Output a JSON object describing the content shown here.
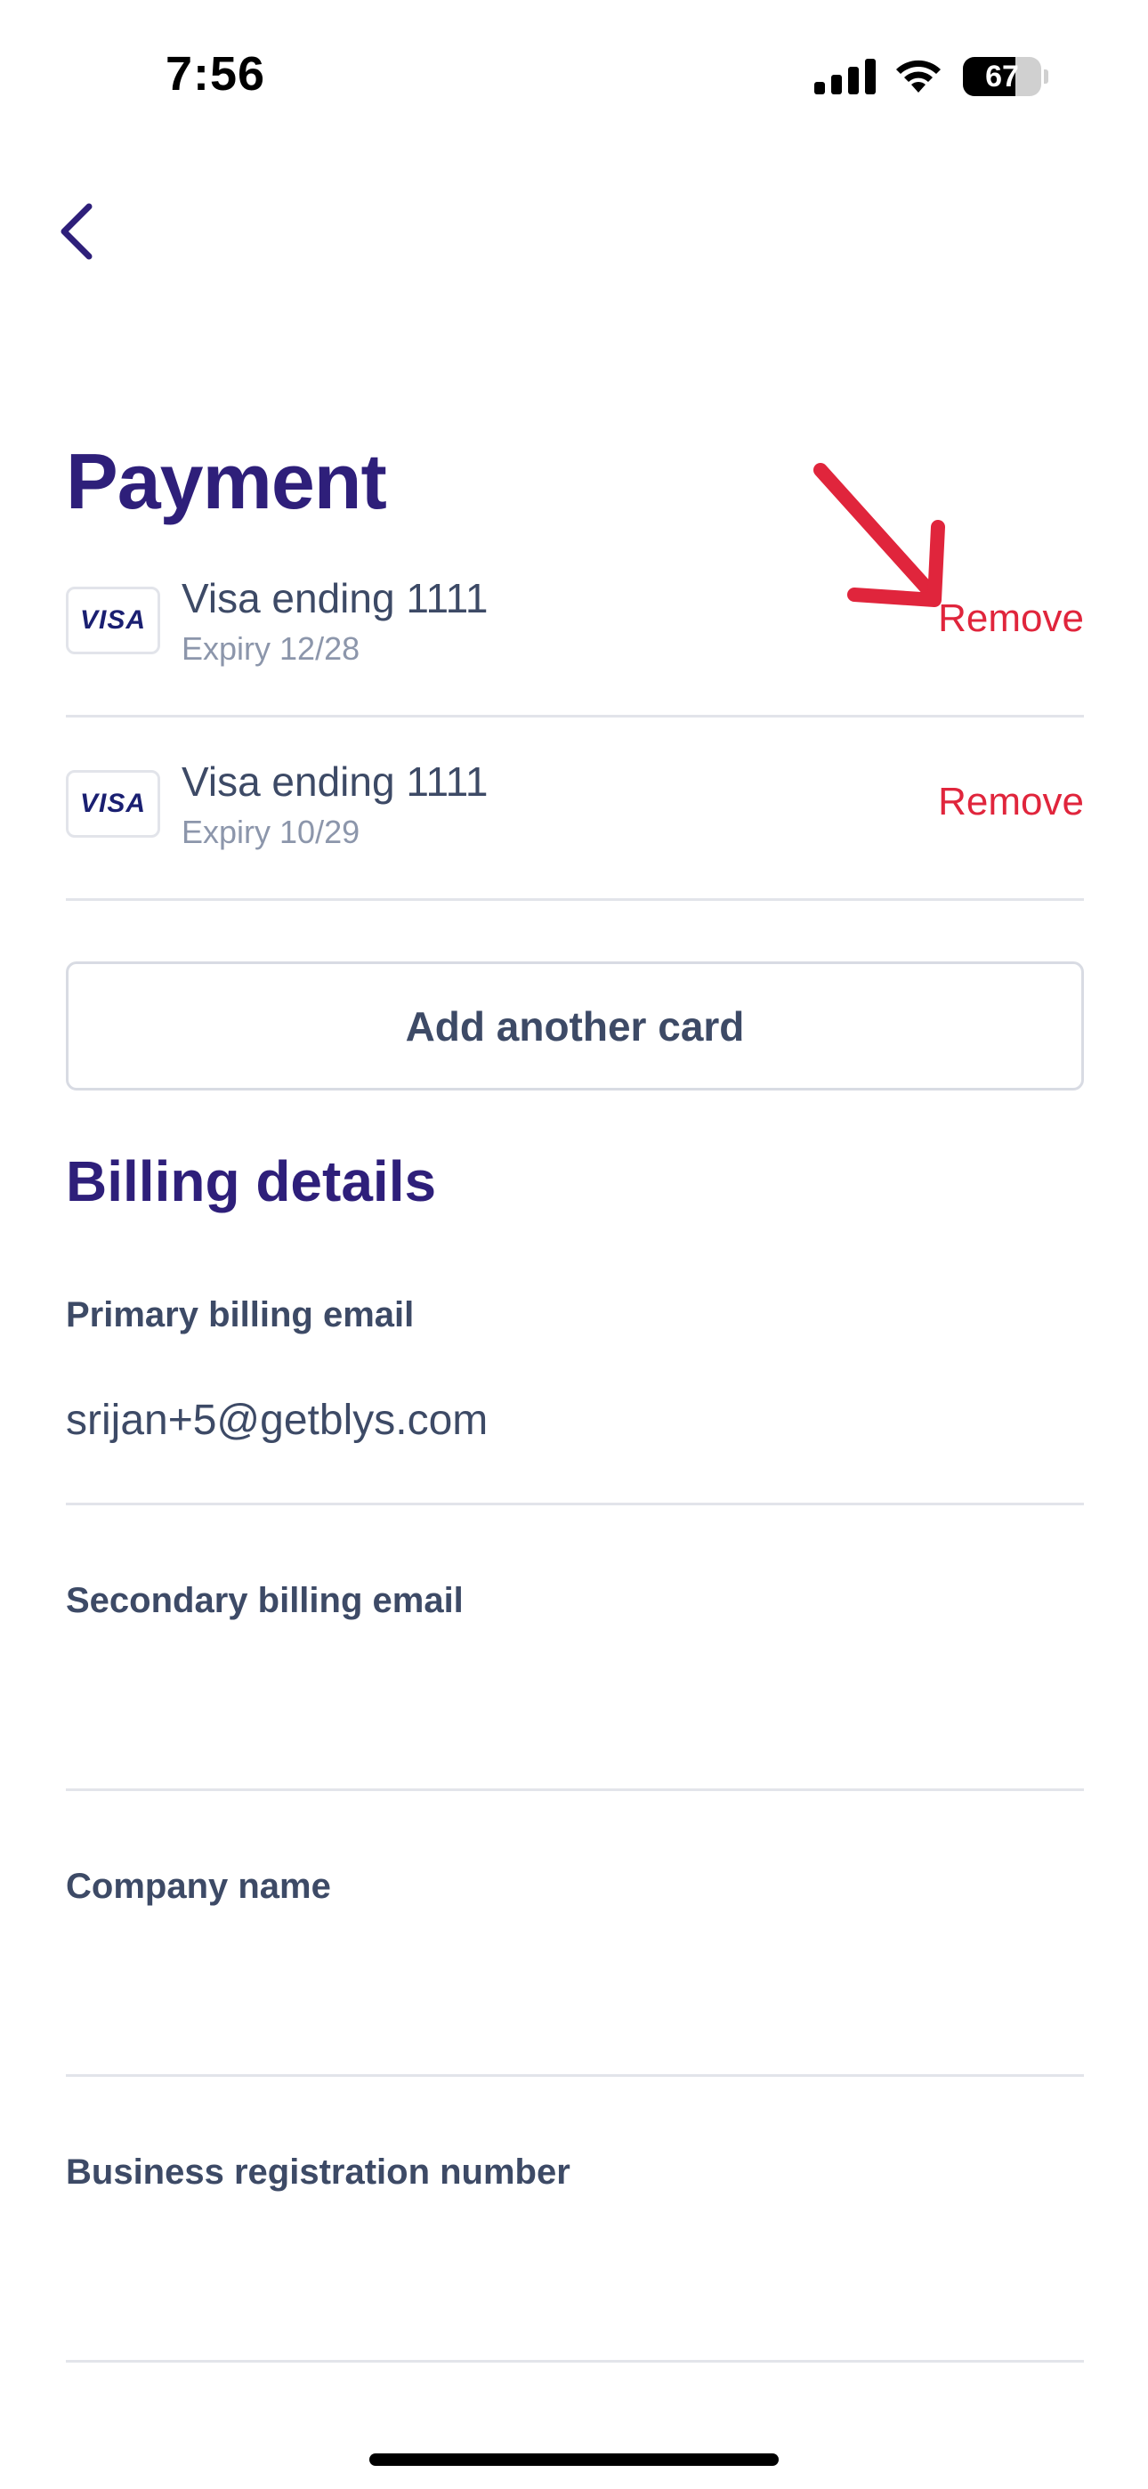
{
  "status_bar": {
    "time": "7:56",
    "battery_level": "67",
    "battery_fraction": 0.67,
    "icons": [
      "signal-icon",
      "wifi-icon",
      "battery-icon"
    ]
  },
  "nav": {
    "back_icon": "chevron-left-icon"
  },
  "payment": {
    "title": "Payment",
    "cards": [
      {
        "brand": "VISA",
        "name": "Visa ending 1111",
        "expiry": "Expiry 12/28",
        "remove_label": "Remove"
      },
      {
        "brand": "VISA",
        "name": "Visa ending 1111",
        "expiry": "Expiry 10/29",
        "remove_label": "Remove"
      }
    ],
    "add_card_label": "Add another card"
  },
  "billing": {
    "title": "Billing details",
    "fields": [
      {
        "label": "Primary billing email",
        "value": "srijan+5@getblys.com"
      },
      {
        "label": "Secondary billing email",
        "value": ""
      },
      {
        "label": "Company name",
        "value": ""
      },
      {
        "label": "Business registration number",
        "value": ""
      }
    ]
  },
  "colors": {
    "title": "#2e1f7a",
    "text": "#3d4a66",
    "muted": "#8c96ab",
    "danger": "#e0253c",
    "divider": "#e2e4ea",
    "annotation": "#e0253c"
  }
}
